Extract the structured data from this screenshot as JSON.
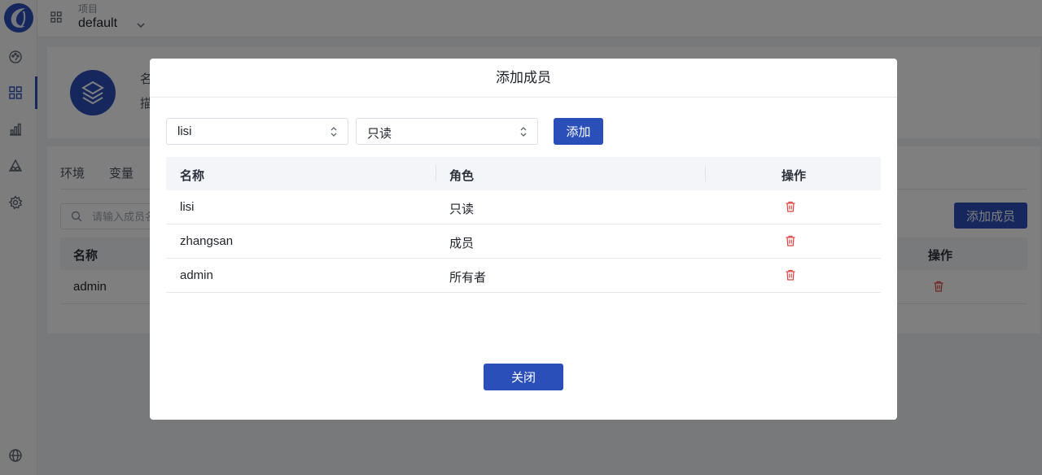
{
  "topbar": {
    "project_label": "项目",
    "project_name": "default"
  },
  "project_card": {
    "name_label_partial": "名",
    "desc_label_partial": "描"
  },
  "background": {
    "tabs": [
      {
        "label": "环境"
      },
      {
        "label": "变量"
      }
    ],
    "search_placeholder": "请输入成员名称",
    "add_member_button": "添加成员",
    "table": {
      "columns": {
        "name": "名称",
        "action": "操作"
      },
      "rows": [
        {
          "name": "admin"
        }
      ]
    }
  },
  "modal": {
    "title": "添加成员",
    "user_select": {
      "value": "lisi"
    },
    "role_select": {
      "value": "只读"
    },
    "add_button": "添加",
    "table": {
      "columns": {
        "name": "名称",
        "role": "角色",
        "action": "操作"
      },
      "rows": [
        {
          "name": "lisi",
          "role": "只读"
        },
        {
          "name": "zhangsan",
          "role": "成员"
        },
        {
          "name": "admin",
          "role": "所有者"
        }
      ]
    },
    "close_button": "关闭"
  },
  "colors": {
    "primary": "#2a4fb8",
    "danger": "#e0413f",
    "header_bg": "#f3f5f8"
  },
  "icons": [
    "logo-icon",
    "dashboard-icon",
    "apps-icon",
    "chart-icon",
    "shapes-icon",
    "settings-icon",
    "globe-icon",
    "grid-icon",
    "chevron-down-icon",
    "layers-icon",
    "search-icon",
    "select-arrows-icon",
    "trash-icon"
  ]
}
